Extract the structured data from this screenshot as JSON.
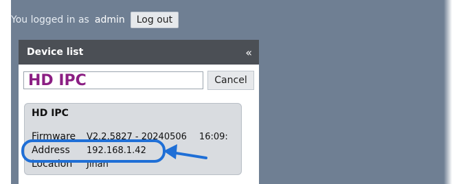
{
  "topbar": {
    "logged_in_text": "You logged in as",
    "username": "admin",
    "logout_label": "Log out"
  },
  "panel": {
    "title": "Device list",
    "collapse_glyph": "«",
    "search_value": "HD IPC",
    "cancel_label": "Cancel",
    "device": {
      "name": "HD IPC",
      "firmware_label": "Firmware",
      "firmware_value": "V2.2.5827 - 20240506",
      "firmware_time": "16:09:",
      "address_label": "Address",
      "address_value": "192.168.1.42",
      "location_label": "Location",
      "location_value": "Jinan"
    }
  },
  "colors": {
    "background": "#6f7f93",
    "panel_header": "#4b4f55",
    "search_text": "#8b1f83",
    "annotation": "#1f6fd6"
  }
}
